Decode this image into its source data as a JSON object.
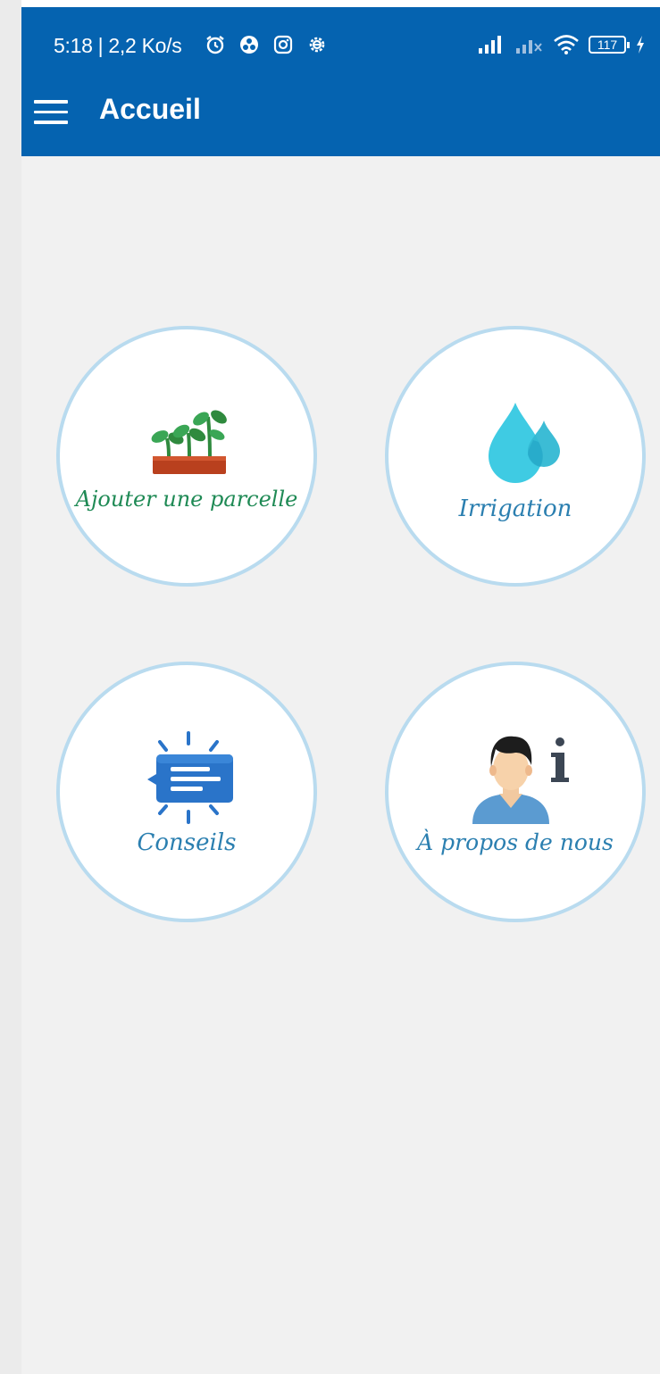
{
  "status_bar": {
    "time_speed": "5:18 | 2,2 Ko/s",
    "battery_level": "117",
    "icons": [
      "alarm-icon",
      "app-icon",
      "instagram-icon",
      "settings-icon",
      "signal-icon",
      "signal-weak-icon",
      "wifi-icon",
      "battery-icon",
      "charging-icon"
    ]
  },
  "toolbar": {
    "title": "Accueil",
    "menu_icon": "menu-icon"
  },
  "tiles": [
    {
      "label": "Ajouter une parcelle",
      "icon": "plant-icon",
      "color": "#1f8a55"
    },
    {
      "label": "Irrigation",
      "icon": "water-drop-icon",
      "color": "#2b7fb0"
    },
    {
      "label": "Conseils",
      "icon": "message-icon",
      "color": "#2b7fb0"
    },
    {
      "label": "À propos de nous",
      "icon": "about-user-icon",
      "color": "#2b7fb0"
    }
  ],
  "colors": {
    "appbar": "#0563b0",
    "background": "#f1f1f1",
    "tile_border": "#b9dbef"
  }
}
